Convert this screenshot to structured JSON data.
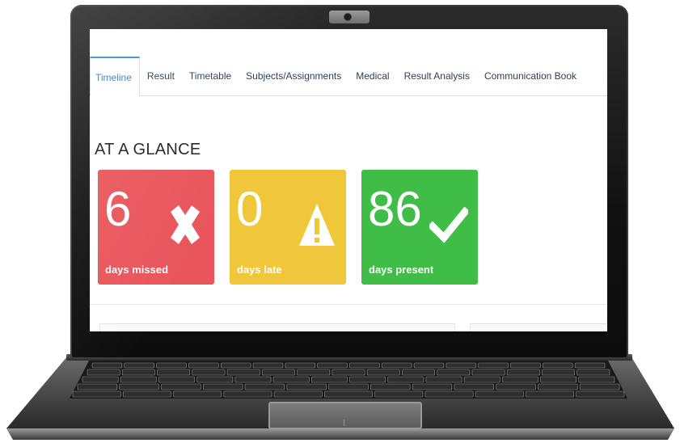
{
  "tabs": [
    {
      "label": "Timeline",
      "active": true
    },
    {
      "label": "Result",
      "active": false
    },
    {
      "label": "Timetable",
      "active": false
    },
    {
      "label": "Subjects/Assignments",
      "active": false
    },
    {
      "label": "Medical",
      "active": false
    },
    {
      "label": "Result Analysis",
      "active": false
    },
    {
      "label": "Communication Book",
      "active": false
    }
  ],
  "glance": {
    "title": "AT A GLANCE",
    "cards": [
      {
        "value": "6",
        "label": "days missed",
        "icon": "close-icon",
        "color": "#e9555b"
      },
      {
        "value": "0",
        "label": "days late",
        "icon": "warning-icon",
        "color": "#f0c73a"
      },
      {
        "value": "86",
        "label": "days present",
        "icon": "check-icon",
        "color": "#3fbd46"
      }
    ]
  }
}
